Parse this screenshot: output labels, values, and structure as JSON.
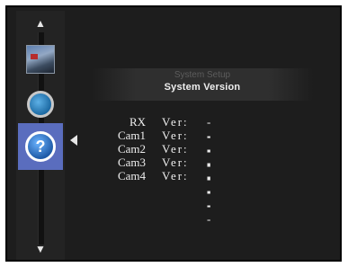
{
  "menu": {
    "subtitle": "System Setup",
    "title": "System Version"
  },
  "sidebar": {
    "up_arrow": "▲",
    "down_arrow": "▼",
    "items": [
      {
        "icon": "photo-icon",
        "active": false
      },
      {
        "icon": "refresh-icon",
        "active": false
      },
      {
        "icon": "help-icon",
        "glyph": "?",
        "active": true
      }
    ]
  },
  "versions": [
    {
      "device": "RX",
      "ver_label": "Ver:",
      "value": "----"
    },
    {
      "device": "Cam1",
      "ver_label": "Ver:",
      "value": "----"
    },
    {
      "device": "Cam2",
      "ver_label": "Ver:",
      "value": "----"
    },
    {
      "device": "Cam3",
      "ver_label": "Ver:",
      "value": "----"
    },
    {
      "device": "Cam4",
      "ver_label": "Ver:",
      "value": "----"
    }
  ],
  "colors": {
    "selected_tile": "#5a6dbe",
    "background": "#1d1d1d"
  }
}
